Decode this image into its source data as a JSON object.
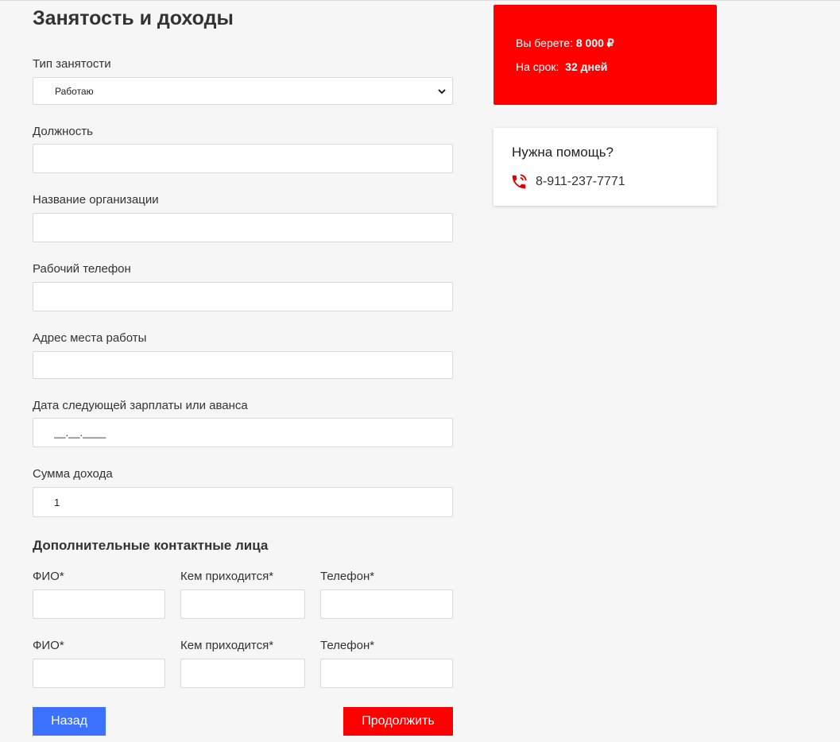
{
  "form": {
    "title": "Занятость и доходы",
    "employment_type": {
      "label": "Тип занятости",
      "value": "Работаю"
    },
    "position": {
      "label": "Должность",
      "value": ""
    },
    "organization": {
      "label": "Название организации",
      "value": ""
    },
    "work_phone": {
      "label": "Рабочий телефон",
      "value": ""
    },
    "work_address": {
      "label": "Адрес места работы",
      "value": ""
    },
    "next_salary_date": {
      "label": "Дата следующей зарплаты или аванса",
      "value": "__.__.____"
    },
    "income": {
      "label": "Сумма дохода",
      "value": "1"
    }
  },
  "contacts": {
    "title": "Дополнительные контактные лица",
    "rows": [
      {
        "name_label": "ФИО*",
        "relation_label": "Кем приходится*",
        "phone_label": "Телефон*"
      },
      {
        "name_label": "ФИО*",
        "relation_label": "Кем приходится*",
        "phone_label": "Телефон*"
      }
    ]
  },
  "buttons": {
    "back": "Назад",
    "next": "Продолжить"
  },
  "summary": {
    "amount_label": "Вы берете:",
    "amount_value": "8 000 ₽",
    "term_label": "На срок:",
    "term_value": "32 дней"
  },
  "help": {
    "title": "Нужна помощь?",
    "phone": "8-911-237-7771",
    "icon": "phone-icon"
  },
  "colors": {
    "accent": "#ff0000",
    "back_button": "#3d71ff",
    "background": "#f6f6f6"
  }
}
